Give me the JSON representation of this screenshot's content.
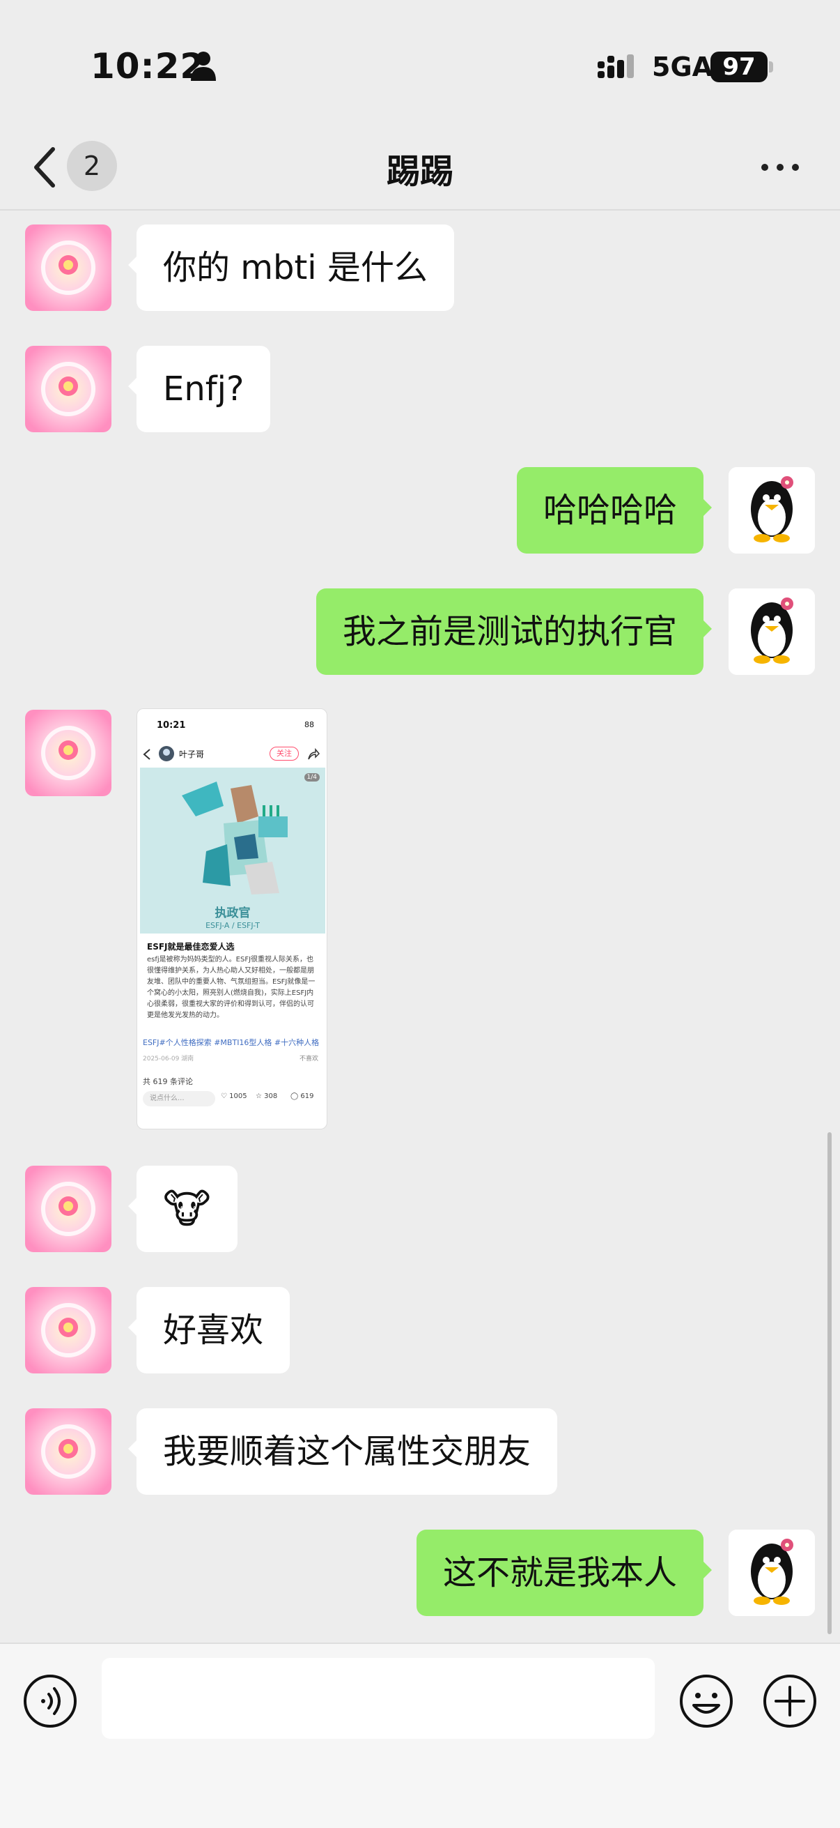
{
  "status_bar": {
    "time": "10:22",
    "network": "5GA",
    "battery": "97"
  },
  "navbar": {
    "unread_count": "2",
    "title": "踢踢"
  },
  "messages": [
    {
      "side": "left",
      "text": "你的 mbti 是什么"
    },
    {
      "side": "left",
      "text": "Enfj?"
    },
    {
      "side": "right",
      "text": "哈哈哈哈"
    },
    {
      "side": "right",
      "text": "我之前是测试的执行官"
    },
    {
      "side": "left",
      "type": "image"
    },
    {
      "side": "left",
      "text": "🐮"
    },
    {
      "side": "left",
      "text": "好喜欢"
    },
    {
      "side": "left",
      "text": "我要顺着这个属性交朋友"
    },
    {
      "side": "right",
      "text": "这不就是我本人"
    }
  ],
  "shared_post": {
    "time": "10:21",
    "status_right": "88",
    "author": "叶子哥",
    "follow_label": "关注",
    "page_indicator": "1/4",
    "hero_title": "执政官",
    "hero_subtitle": "ESFJ-A / ESFJ-T",
    "post_title": "ESFJ就是最佳恋爱人选",
    "post_body": "esfj是被称为妈妈类型的人。ESFJ很重视人际关系，也很懂得维护关系，为人热心助人又好相处，一般都是朋友堆、团队中的重要人物、气氛组担当。ESFJ就像是一个窝心的小太阳，照亮别人(燃烧自我)，实际上ESFJ内心很柔弱，很重视大家的评价和得到认可，伴侣的认可更是他发光发热的动力。",
    "tags": "ESFJ#个人性格探索 #MBTI16型人格 #十六种人格",
    "date": "2025-06-09 湖南",
    "dislike": "不喜欢",
    "comments_count": "共 619 条评论",
    "comment_placeholder": "说点什么...",
    "likes": "1005",
    "stars": "308",
    "comments": "619"
  },
  "input_bar": {
    "placeholder": ""
  },
  "colors": {
    "background": "#ededed",
    "sent_bubble": "#95ec69",
    "received_bubble": "#ffffff"
  }
}
